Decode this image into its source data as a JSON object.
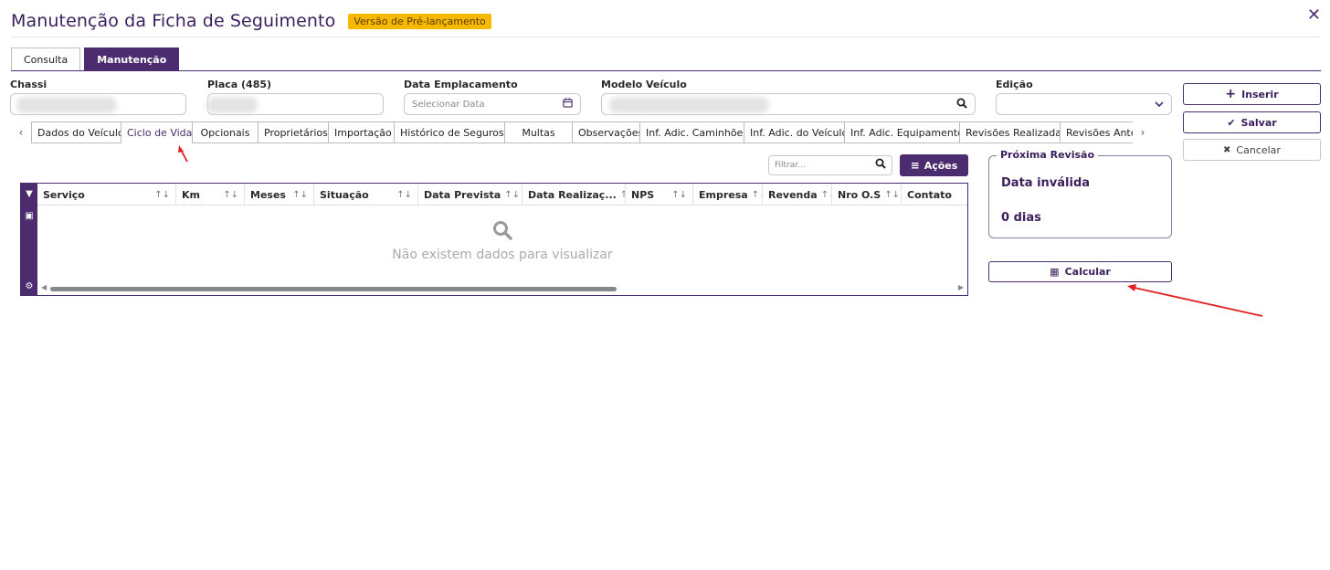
{
  "window": {
    "title": "Manutenção da Ficha de Seguimento",
    "badge": "Versão de Pré-lançamento",
    "close_icon": "close-icon"
  },
  "main_tabs": [
    {
      "label": "Consulta",
      "active": false
    },
    {
      "label": "Manutenção",
      "active": true
    }
  ],
  "fields": {
    "chassi": {
      "label": "Chassi",
      "value": ""
    },
    "placa": {
      "label": "Placa (485)",
      "value": ""
    },
    "data_emplacamento": {
      "label": "Data Emplacamento",
      "placeholder": "Selecionar Data"
    },
    "modelo_veiculo": {
      "label": "Modelo Veículo",
      "value": ""
    },
    "edicao": {
      "label": "Edição",
      "value": ""
    }
  },
  "actions": {
    "inserir": "Inserir",
    "salvar": "Salvar",
    "cancelar": "Cancelar"
  },
  "sub_tabs": [
    {
      "label": "Dados do Veículo",
      "active": false
    },
    {
      "label": "Ciclo de Vida",
      "active": true
    },
    {
      "label": "Opcionais",
      "active": false
    },
    {
      "label": "Proprietários",
      "active": false
    },
    {
      "label": "Importação",
      "active": false
    },
    {
      "label": "Histórico de Seguros",
      "active": false
    },
    {
      "label": "Multas",
      "active": false
    },
    {
      "label": "Observações",
      "active": false
    },
    {
      "label": "Inf. Adic. Caminhões",
      "active": false
    },
    {
      "label": "Inf. Adic. do Veículo",
      "active": false
    },
    {
      "label": "Inf. Adic. Equipamento",
      "active": false
    },
    {
      "label": "Revisões Realizadas",
      "active": false
    },
    {
      "label": "Revisões Ante",
      "active": false
    }
  ],
  "grid": {
    "filter_placeholder": "Filtrar...",
    "acoes_label": "Ações",
    "columns": [
      "Serviço",
      "Km",
      "Meses",
      "Situação",
      "Data Prevista",
      "Data Realizaç...",
      "NPS",
      "Empresa",
      "Revenda",
      "Nro O.S",
      "Contato"
    ],
    "empty_message": "Não existem dados para visualizar",
    "rows": []
  },
  "proxima_revisao": {
    "legend": "Próxima Revisão",
    "date": "Data inválida",
    "days": "0 dias"
  },
  "calcular_label": "Calcular",
  "colors": {
    "primary": "#4b2c6f",
    "badge": "#f6b900",
    "annotation": "#e02020"
  }
}
